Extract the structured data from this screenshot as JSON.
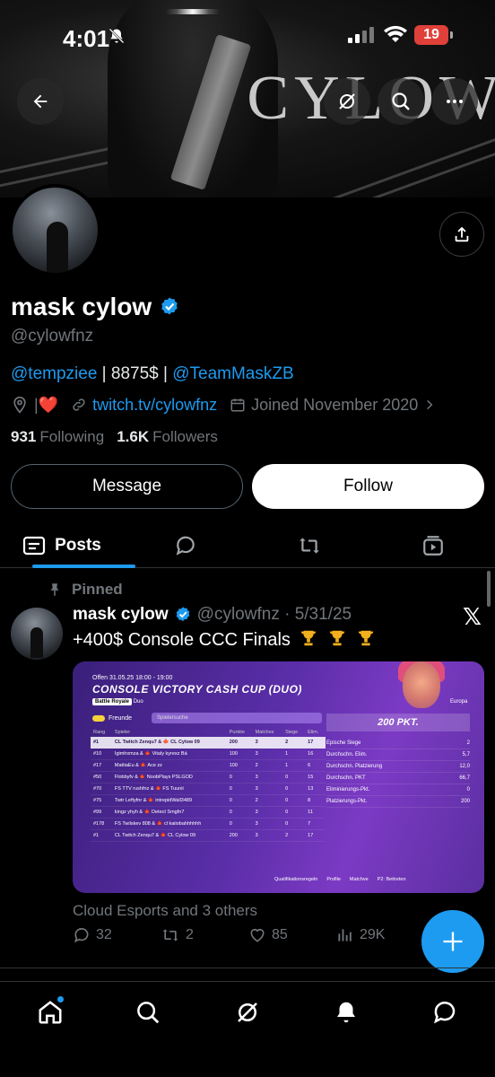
{
  "status_bar": {
    "time": "4:01",
    "battery": "19"
  },
  "banner": {
    "wordmark": "CYLOW"
  },
  "profile": {
    "name": "mask cylow",
    "handle": "@cylowfnz",
    "bio": {
      "mention1": "@tempziee",
      "sep1": " | 8875$ | ",
      "mention2": "@TeamMaskZB"
    },
    "location": "|❤️",
    "website": "twitch.tv/cylowfnz",
    "joined": "Joined November 2020",
    "following_count": "931",
    "following_label": "Following",
    "followers_count": "1.6K",
    "followers_label": "Followers"
  },
  "buttons": {
    "message": "Message",
    "follow": "Follow"
  },
  "tabs": {
    "posts": "Posts"
  },
  "post": {
    "pinned_label": "Pinned",
    "author": "mask cylow",
    "handle_date": "@cylowfnz · 5/31/25",
    "text": "+400$ Console CCC Finals",
    "liked_by": "Cloud Esports and 3 others",
    "replies": "32",
    "reposts": "2",
    "likes": "85",
    "views": "29K",
    "media": {
      "status": "Offen   31.05.25 18:00 - 19:00",
      "title": "CONSOLE VICTORY CASH CUP (DUO)",
      "mode": "Battle Royale",
      "mode_suffix": "Duo",
      "friends": "Freunde",
      "search_placeholder": "Spielersuche",
      "headers": [
        "Rang",
        "Spieler",
        "Punkte",
        "Matches",
        "Siege",
        "Elim."
      ],
      "rows": [
        [
          "#1",
          "CL Twitch Zenqu7 & 🍁 CL Cylow 09",
          "200",
          "3",
          "2",
          "17"
        ],
        [
          "#10",
          "Igimhxmza & 🍁 Vitaly kyrexz Bá",
          "100",
          "3",
          "1",
          "16"
        ],
        [
          "#17",
          "MattiaEu & 🍁 Ace zz",
          "100",
          "2",
          "1",
          "6"
        ],
        [
          "#50",
          "Flobbyfv & 🍁 NoobPlays PSLGOD",
          "0",
          "3",
          "0",
          "15"
        ],
        [
          "#70",
          "FS TTV rushfnz & 🍁 FS Tuunii",
          "0",
          "3",
          "0",
          "13"
        ],
        [
          "#75",
          "Twtr Leftyfnr & 🍁 intrepidWall3489",
          "0",
          "2",
          "0",
          "8"
        ],
        [
          "#99",
          "kingz yhyh & 🍁 Detect Smgfn7",
          "0",
          "3",
          "0",
          "11"
        ],
        [
          "#178",
          "FS Twilskev 808 & 🍁 cl kaiiobahhhhhh",
          "0",
          "3",
          "0",
          "7"
        ],
        [
          "#1",
          "CL Twitch Zenqu7 & 🍁 CL Cylow 09",
          "200",
          "3",
          "2",
          "17"
        ]
      ],
      "region": "Europa",
      "points": "200 PKT.",
      "stats": [
        [
          "Epische Siege",
          "2"
        ],
        [
          "Durchschn. Elim.",
          "5,7"
        ],
        [
          "Durchschn. Platzierung",
          "12,0"
        ],
        [
          "Durchschn. PKT",
          "66,7"
        ],
        [
          "Eliminierungs-Pkt.",
          "0"
        ],
        [
          "Platzierungs-Pkt.",
          "200"
        ]
      ],
      "footer": [
        "Qualifikationsregeln",
        "Profile",
        "Matchve",
        "P2: Beitreten"
      ]
    }
  },
  "colors": {
    "accent": "#1d9bf0",
    "background": "#000000",
    "muted": "#71767b",
    "battery": "#e0403a"
  }
}
